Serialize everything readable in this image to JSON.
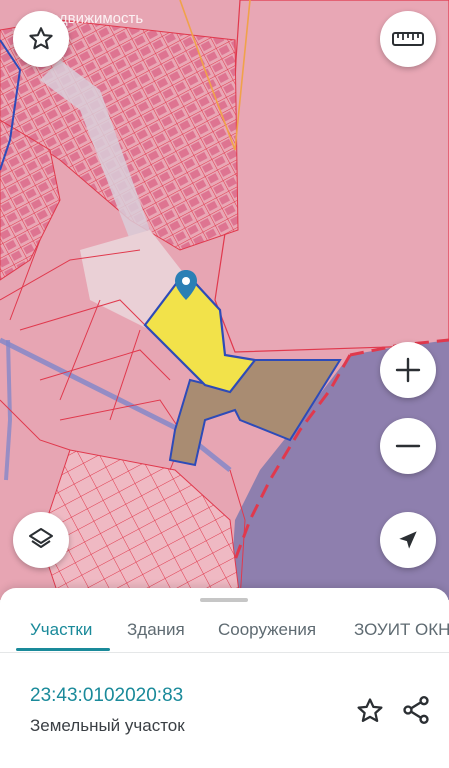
{
  "map": {
    "watermark": "Недвижимость",
    "colors": {
      "land": "#e7a5b3",
      "land_light": "#efc3c9",
      "water": "#8e7fae",
      "parcel_border": "#e0394d",
      "selected_fill": "#f2e24a",
      "neighbor_fill": "#a98c72",
      "outline": "#2d4bb8",
      "road": "#d9cdd8",
      "zone_line": "#f0a24a"
    },
    "marker_icon": "location-pin-icon"
  },
  "controls": {
    "favorite_icon": "star-outline-icon",
    "ruler_icon": "ruler-icon",
    "zoom_in_icon": "plus-icon",
    "zoom_out_icon": "minus-icon",
    "layers_icon": "layers-icon",
    "locate_icon": "navigation-arrow-icon"
  },
  "sheet": {
    "tabs": [
      {
        "label": "Участки",
        "active": true
      },
      {
        "label": "Здания",
        "active": false
      },
      {
        "label": "Сооружения",
        "active": false
      },
      {
        "label": "ЗОУИТ ОКН",
        "active": false
      }
    ],
    "cadastral_number": "23:43:0102020:83",
    "object_type": "Земельный участок",
    "accent": "#1a8a9a"
  }
}
